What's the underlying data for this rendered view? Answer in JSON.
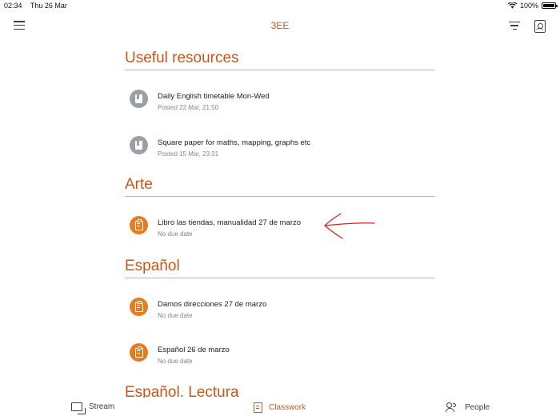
{
  "status_bar": {
    "time": "02:34",
    "date": "Thu 26 Mar",
    "battery": "100%"
  },
  "app_bar": {
    "title": "3EE"
  },
  "sections": [
    {
      "title": "Useful resources",
      "items": [
        {
          "name": "Daily English timetable Mon-Wed",
          "meta": "Posted 22 Mar, 21:50",
          "kind": "material"
        },
        {
          "name": "Square paper for maths, mapping, graphs etc",
          "meta": "Posted 15 Mar, 23:31",
          "kind": "material"
        }
      ]
    },
    {
      "title": "Arte",
      "items": [
        {
          "name": "Libro las tiendas, manualidad 27 de marzo",
          "meta": "No due date",
          "kind": "assignment"
        }
      ]
    },
    {
      "title": "Español",
      "items": [
        {
          "name": "Damos direcciones 27 de marzo",
          "meta": "No due date",
          "kind": "assignment"
        },
        {
          "name": "Español 26 de marzo",
          "meta": "No due date",
          "kind": "assignment"
        }
      ]
    },
    {
      "title": "Español. Lectura",
      "items": []
    }
  ],
  "bottom_nav": {
    "stream": "Stream",
    "classwork": "Classwork",
    "people": "People"
  },
  "colors": {
    "accent": "#c5581b",
    "assignment_icon": "#e67c22",
    "material_icon": "#9aa0a6",
    "rule": "#e8a77f",
    "annotation": "#e02020"
  }
}
